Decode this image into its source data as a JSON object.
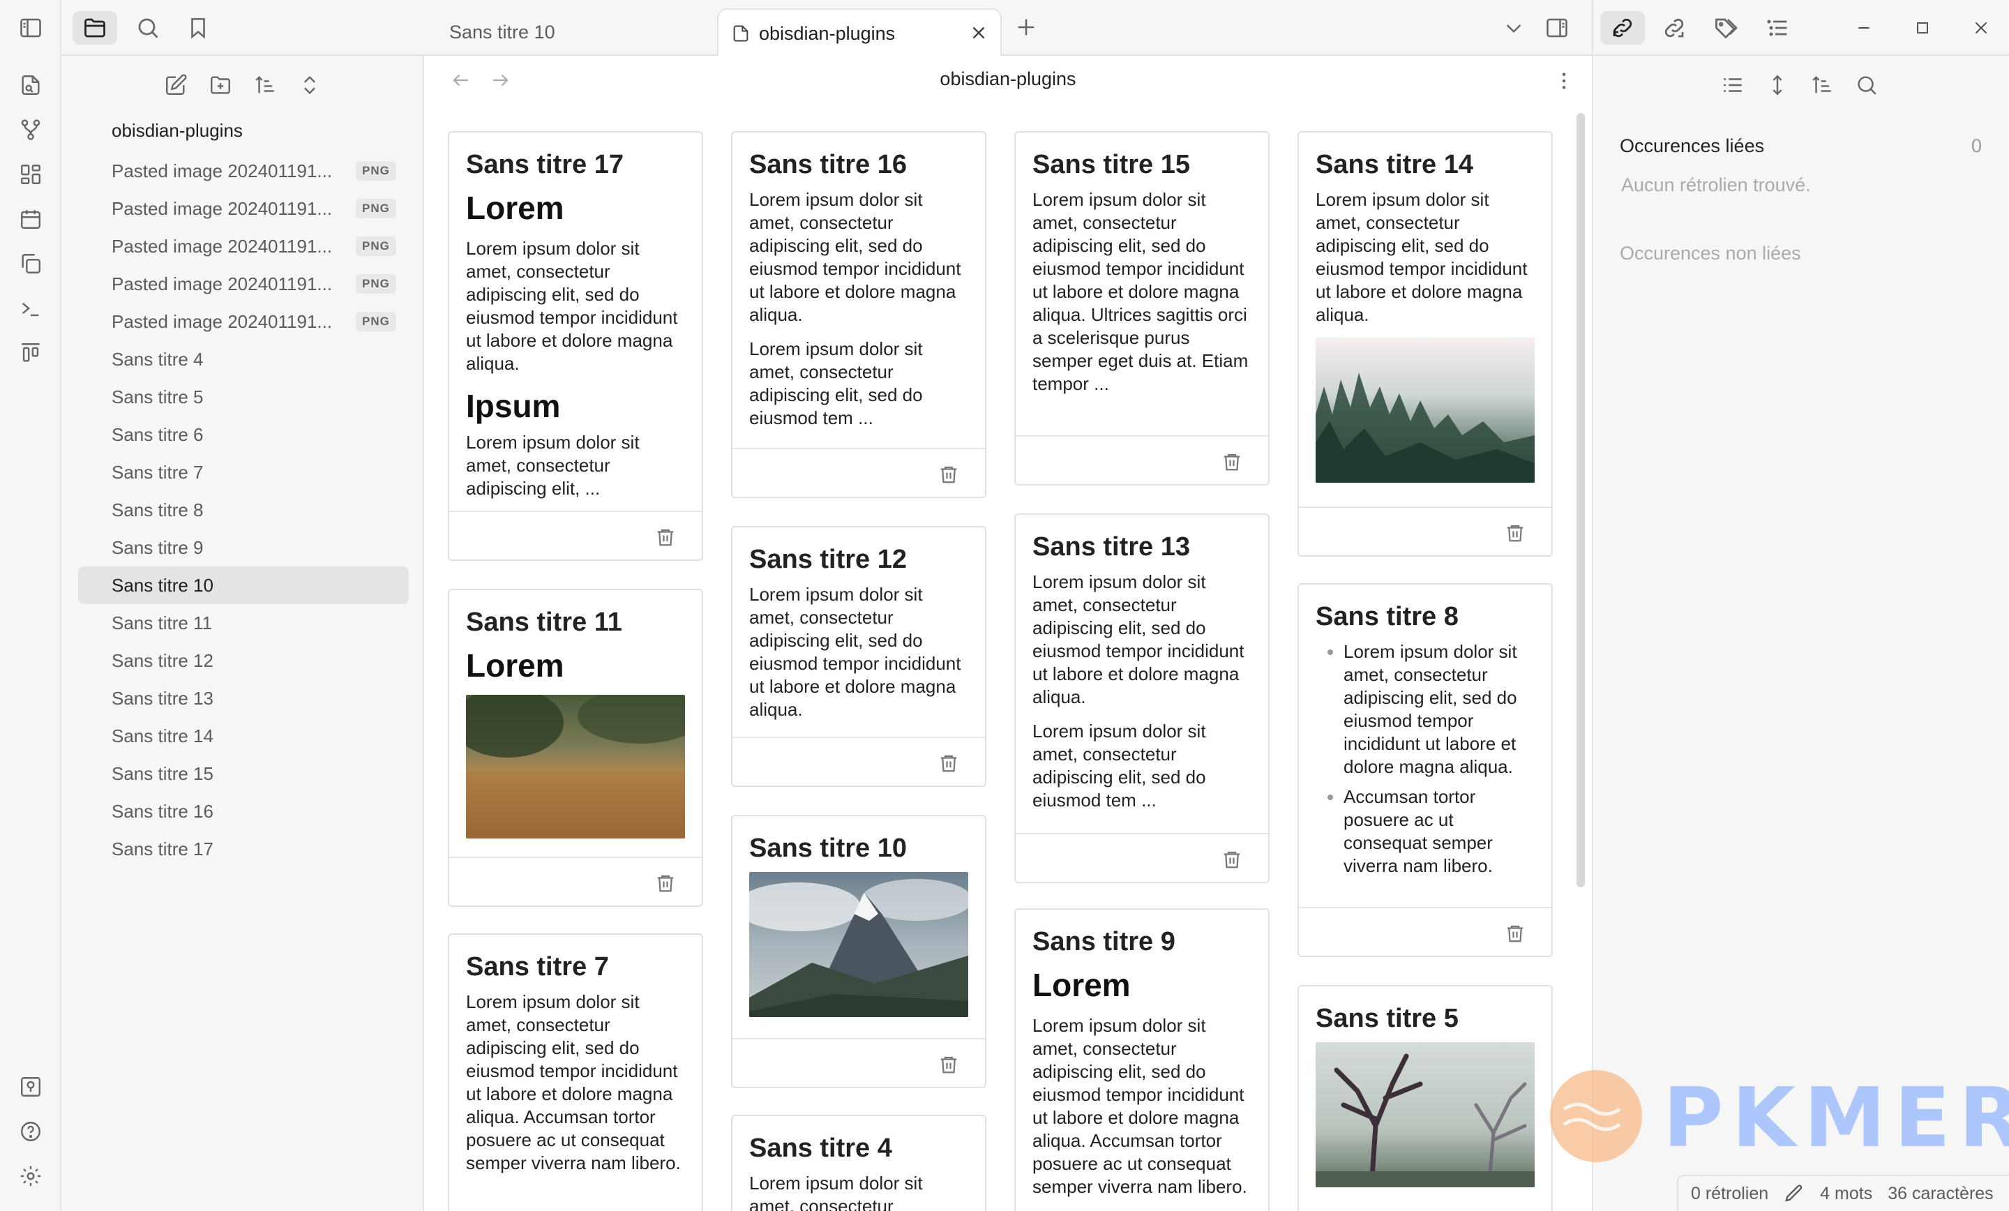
{
  "left_panel": {
    "vault_folder": "obisdian-plugins",
    "files": [
      {
        "name": "Pasted image 202401191...",
        "badge": "PNG"
      },
      {
        "name": "Pasted image 202401191...",
        "badge": "PNG"
      },
      {
        "name": "Pasted image 202401191...",
        "badge": "PNG"
      },
      {
        "name": "Pasted image 202401191...",
        "badge": "PNG"
      },
      {
        "name": "Pasted image 202401191...",
        "badge": "PNG"
      },
      {
        "name": "Sans titre 4"
      },
      {
        "name": "Sans titre 5"
      },
      {
        "name": "Sans titre 6"
      },
      {
        "name": "Sans titre 7"
      },
      {
        "name": "Sans titre 8"
      },
      {
        "name": "Sans titre 9"
      },
      {
        "name": "Sans titre 10",
        "selected": true
      },
      {
        "name": "Sans titre 11"
      },
      {
        "name": "Sans titre 12"
      },
      {
        "name": "Sans titre 13"
      },
      {
        "name": "Sans titre 14"
      },
      {
        "name": "Sans titre 15"
      },
      {
        "name": "Sans titre 16"
      },
      {
        "name": "Sans titre 17"
      }
    ]
  },
  "tabs": [
    {
      "label": "Sans titre 10",
      "active": false
    },
    {
      "label": "obisdian-plugins",
      "active": true
    }
  ],
  "view": {
    "title": "obisdian-plugins"
  },
  "cards": [
    {
      "title": "Sans titre 17",
      "h2a": "Lorem",
      "p1": "Lorem ipsum dolor sit amet, consectetur adipiscing elit, sed do eiusmod tempor incididunt ut labore et dolore magna aliqua.",
      "h2b": "Ipsum",
      "p2": "Lorem ipsum dolor sit amet, consectetur adipiscing elit, ..."
    },
    {
      "title": "Sans titre 11",
      "h2a": "Lorem"
    },
    {
      "title": "Sans titre 7",
      "p1": "Lorem ipsum dolor sit amet, consectetur adipiscing elit, sed do eiusmod tempor incididunt ut labore et dolore magna aliqua. Accumsan tortor posuere ac ut consequat semper viverra nam libero."
    },
    {
      "title": "Sans titre 16",
      "p1": "Lorem ipsum dolor sit amet, consectetur adipiscing elit, sed do eiusmod tempor incididunt ut labore et dolore magna aliqua.",
      "p2": "Lorem ipsum dolor sit amet, consectetur adipiscing elit, sed do eiusmod tem ..."
    },
    {
      "title": "Sans titre 12",
      "p1": "Lorem ipsum dolor sit amet, consectetur adipiscing elit, sed do eiusmod tempor incididunt ut labore et dolore magna aliqua."
    },
    {
      "title": "Sans titre 10"
    },
    {
      "title": "Sans titre 4",
      "p1": "Lorem ipsum dolor sit amet, consectetur"
    },
    {
      "title": "Sans titre 15",
      "p1": "Lorem ipsum dolor sit amet, consectetur adipiscing elit, sed do eiusmod tempor incididunt ut labore et dolore magna aliqua. Ultrices sagittis orci a scelerisque purus semper eget duis at. Etiam tempor ..."
    },
    {
      "title": "Sans titre 13",
      "p1": "Lorem ipsum dolor sit amet, consectetur adipiscing elit, sed do eiusmod tempor incididunt ut labore et dolore magna aliqua.",
      "p2": "Lorem ipsum dolor sit amet, consectetur adipiscing elit, sed do eiusmod tem ..."
    },
    {
      "title": "Sans titre 9",
      "h2a": "Lorem",
      "p1": "Lorem ipsum dolor sit amet, consectetur adipiscing elit, sed do eiusmod tempor incididunt ut labore et dolore magna aliqua. Accumsan tortor posuere ac ut consequat semper viverra nam libero."
    },
    {
      "title": "Sans titre 14",
      "p1": "Lorem ipsum dolor sit amet, consectetur adipiscing elit, sed do eiusmod tempor incididunt ut labore et dolore magna aliqua."
    },
    {
      "title": "Sans titre 8",
      "li1": "Lorem ipsum dolor sit amet, consectetur adipiscing elit, sed do eiusmod tempor incididunt ut labore et dolore magna aliqua.",
      "li2": "Accumsan tortor posuere ac ut consequat semper viverra nam libero."
    },
    {
      "title": "Sans titre 5"
    }
  ],
  "right_panel": {
    "linked_title": "Occurences liées",
    "linked_count": "0",
    "linked_empty": "Aucun rétrolien trouvé.",
    "unlinked_title": "Occurences non liées"
  },
  "status_bar": {
    "backlinks": "0 rétrolien",
    "words": "4 mots",
    "chars": "36 caractères"
  },
  "watermark": "PKMER",
  "icons": {
    "ribbon": [
      "open-quick-switcher-icon",
      "graph-view-icon",
      "canvas-icon",
      "daily-note-icon",
      "templates-icon",
      "command-palette-icon",
      "kanban-icon"
    ],
    "ribbon_bottom": [
      "vault-switcher-icon",
      "help-icon",
      "settings-icon"
    ]
  },
  "colors": {
    "accent": "#705dcf",
    "panel_bg": "#f6f6f6",
    "selected_bg": "#e4e4e4",
    "watermark_blue": "#8fb4ff",
    "watermark_orange": "#f7b98a"
  }
}
